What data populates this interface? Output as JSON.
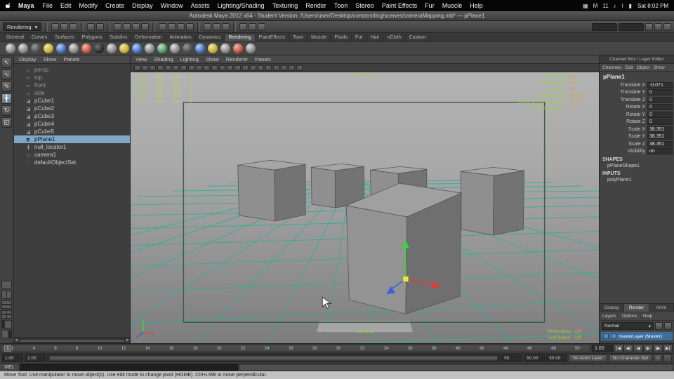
{
  "colors": {
    "grid": "#2fae92",
    "gate": "#3d5c48",
    "hud_label": "#9ccf45",
    "hud_num": "#ccd23f",
    "hud_value": "#d9a43c",
    "selection": "#7fa7c4"
  },
  "macos_menubar": {
    "app_name": "Maya",
    "menus": [
      "File",
      "Edit",
      "Modify",
      "Create",
      "Display",
      "Window",
      "Assets",
      "Lighting/Shading",
      "Texturing",
      "Render",
      "Toon",
      "Stereo",
      "Paint Effects",
      "Fur",
      "Muscle",
      "Help"
    ],
    "status_icons": [
      "▦",
      "M",
      "11",
      "♪",
      "⌇",
      "▮"
    ],
    "clock": "Sat 8:02 PM"
  },
  "title_bar": {
    "title": "Autodesk Maya 2012 x64 - Student Version: /Users/user/Desktop/compositing/scenes/cameraMapping.mb*  —  pPlane1"
  },
  "status_line": {
    "menu_set": "Rendering",
    "dropdown_arrow": "▾"
  },
  "shelf": {
    "tabs": [
      {
        "label": "General"
      },
      {
        "label": "Curves"
      },
      {
        "label": "Surfaces"
      },
      {
        "label": "Polygons"
      },
      {
        "label": "Subdivs"
      },
      {
        "label": "Deformation"
      },
      {
        "label": "Animation"
      },
      {
        "label": "Dynamics"
      },
      {
        "label": "Rendering",
        "active": true
      },
      {
        "label": "PaintEffects"
      },
      {
        "label": "Toon"
      },
      {
        "label": "Muscle"
      },
      {
        "label": "Fluids"
      },
      {
        "label": "Fur"
      },
      {
        "label": "Hair"
      },
      {
        "label": "nCloth"
      },
      {
        "label": "Custom"
      }
    ]
  },
  "toolbox": {
    "tools": [
      {
        "name": "select",
        "glyph": "↖"
      },
      {
        "name": "lasso",
        "glyph": "∿"
      },
      {
        "name": "paint-select",
        "glyph": "✎"
      },
      {
        "name": "move",
        "glyph": "╋",
        "active": true
      },
      {
        "name": "rotate",
        "glyph": "↻"
      },
      {
        "name": "scale",
        "glyph": "◱"
      }
    ]
  },
  "outliner": {
    "menus": [
      "Display",
      "Show",
      "Panels"
    ],
    "items": [
      {
        "label": "persp",
        "glyph": "▱",
        "dim": true
      },
      {
        "label": "top",
        "glyph": "▱",
        "dim": true
      },
      {
        "label": "front",
        "glyph": "▱",
        "dim": true
      },
      {
        "label": "side",
        "glyph": "▱",
        "dim": true
      },
      {
        "label": "pCube1",
        "glyph": "◪"
      },
      {
        "label": "pCube2",
        "glyph": "◪"
      },
      {
        "label": "pCube3",
        "glyph": "◪"
      },
      {
        "label": "pCube4",
        "glyph": "◪"
      },
      {
        "label": "pCube5",
        "glyph": "◪"
      },
      {
        "label": "pPlane1",
        "glyph": "◩",
        "selected": true
      },
      {
        "label": "null_locator1",
        "glyph": "╋"
      },
      {
        "label": "camera1",
        "glyph": "▱"
      },
      {
        "label": "defaultObjectSet",
        "glyph": "∷"
      }
    ]
  },
  "viewport": {
    "menus": [
      "View",
      "Shading",
      "Lighting",
      "Show",
      "Renderer",
      "Panels"
    ],
    "resolution_label": "1280 x 720",
    "camera_label": "camera1",
    "hud_left": [
      {
        "label": "Verts:",
        "v1": "161",
        "v2": "121",
        "v3": "0"
      },
      {
        "label": "Edges:",
        "v1": "280",
        "v2": "220",
        "v3": "0"
      },
      {
        "label": "Faces:",
        "v1": "130",
        "v2": "100",
        "v3": "0"
      },
      {
        "label": "Tris:",
        "v1": "260",
        "v2": "200",
        "v3": "0"
      },
      {
        "label": "UVs:",
        "v1": "191",
        "v2": "121",
        "v3": "0"
      }
    ],
    "hud_right": [
      {
        "label": "Backfaces:",
        "value": "On"
      },
      {
        "label": "Smoothness:",
        "value": "N/A"
      },
      {
        "label": "Instance:",
        "value": "No"
      },
      {
        "label": "Display Layer:",
        "value": "default"
      },
      {
        "label": "Distance From Camera:",
        "value": "14.37"
      },
      {
        "label": "Selected Objects:",
        "value": "1"
      }
    ],
    "hud_bottom_right": [
      {
        "label": "Reflections:",
        "value": "Off"
      },
      {
        "label": "Soft Select:",
        "value": "Off"
      }
    ]
  },
  "channel_box": {
    "header_title": "Channel Box / Layer Editor",
    "menus": [
      "Channels",
      "Edit",
      "Object",
      "Show"
    ],
    "node_name": "pPlane1",
    "attributes": [
      {
        "name": "Translate X",
        "value": "-0.071"
      },
      {
        "name": "Translate Y",
        "value": "0"
      },
      {
        "name": "Translate Z",
        "value": "0"
      },
      {
        "name": "Rotate X",
        "value": "0"
      },
      {
        "name": "Rotate Y",
        "value": "0"
      },
      {
        "name": "Rotate Z",
        "value": "0"
      },
      {
        "name": "Scale X",
        "value": "38.351"
      },
      {
        "name": "Scale Y",
        "value": "38.351"
      },
      {
        "name": "Scale Z",
        "value": "38.351"
      },
      {
        "name": "Visibility",
        "value": "on"
      }
    ],
    "shapes_header": "SHAPES",
    "shape_name": "pPlaneShape1",
    "inputs_header": "INPUTS",
    "input_name": "polyPlane1",
    "layer_editor": {
      "tabs": [
        {
          "label": "Display"
        },
        {
          "label": "Render",
          "active": true
        },
        {
          "label": "Anim"
        }
      ],
      "menus": [
        "Layers",
        "Options",
        "Help"
      ],
      "blend_mode": "Normal",
      "dropdown_arrow": "▾",
      "layer_name": "masterLayer (Master)"
    }
  },
  "time_slider": {
    "labels": [
      "2",
      "4",
      "6",
      "8",
      "10",
      "12",
      "14",
      "16",
      "18",
      "20",
      "22",
      "24",
      "26",
      "28",
      "30",
      "32",
      "34",
      "36",
      "38",
      "40",
      "42",
      "44",
      "46",
      "48",
      "50"
    ],
    "current_frame": "1",
    "current_time": "1.00",
    "playback_buttons": [
      "|◀",
      "◀|",
      "◀",
      "▶",
      "|▶",
      "▶|"
    ]
  },
  "range_slider": {
    "start_fields": [
      "1.00",
      "1.00"
    ],
    "end_fields": [
      "50",
      "50.00",
      "50.00"
    ],
    "anim_layer_button": "No Anim Layer",
    "character_set_button": "No Character Set",
    "autokey_glyph": "●"
  },
  "command_line": {
    "label": "MEL",
    "value": ""
  },
  "help_line": {
    "text": "Move Tool: Use manipulator to move object(s). Use edit mode to change pivot (HOME). Ctrl+LMB to move perpendicular."
  }
}
